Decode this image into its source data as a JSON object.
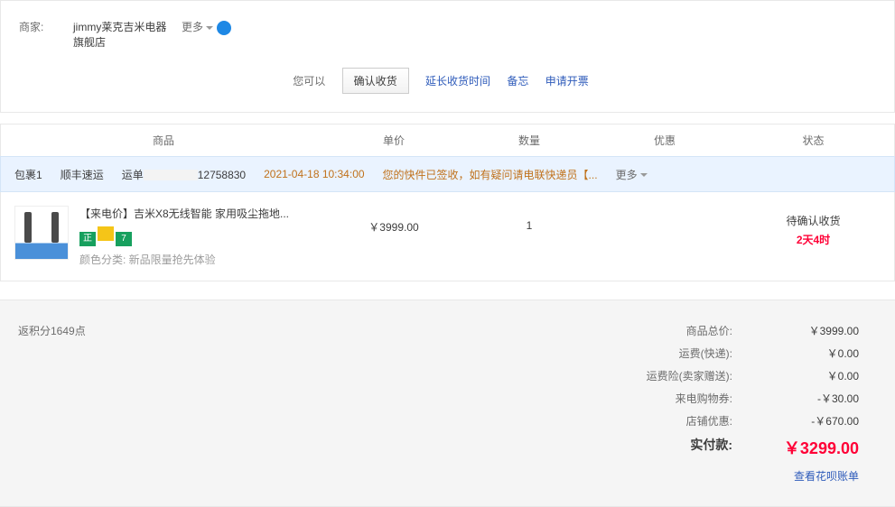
{
  "merchant": {
    "label": "商家:",
    "name": "jimmy莱克吉米电器旗舰店",
    "more": "更多"
  },
  "actions": {
    "prompt": "您可以",
    "confirm": "确认收货",
    "extend": "延长收货时间",
    "note": "备忘",
    "invoice": "申请开票"
  },
  "columns": {
    "product": "商品",
    "price": "单价",
    "qty": "数量",
    "discount": "优惠",
    "status": "状态"
  },
  "package": {
    "label": "包裹1",
    "carrier": "顺丰速运",
    "tracking_label": "运单",
    "tracking_suffix": "12758830",
    "time": "2021-04-18 10:34:00",
    "message": "您的快件已签收，如有疑问请电联快递员【...",
    "more": "更多"
  },
  "item": {
    "title": "【来电价】吉米X8无线智能 家用吸尘拖地...",
    "badge_zheng": "正",
    "badge_seven": "7",
    "sku_label": "颜色分类: ",
    "sku_value": "新品限量抢先体验",
    "price": "￥3999.00",
    "qty": "1",
    "status": "待确认收货",
    "countdown": "2天4时"
  },
  "summary": {
    "points": "返积分1649点",
    "rows": [
      {
        "label": "商品总价:",
        "value": "￥3999.00"
      },
      {
        "label": "运费(快递):",
        "value": "￥0.00"
      },
      {
        "label": "运费险(卖家赠送):",
        "value": "￥0.00"
      },
      {
        "label": "来电购物券:",
        "value": "-￥30.00"
      },
      {
        "label": "店铺优惠:",
        "value": "-￥670.00"
      }
    ],
    "final_label": "实付款:",
    "final_value": "￥3299.00",
    "huabei": "查看花呗账单"
  }
}
